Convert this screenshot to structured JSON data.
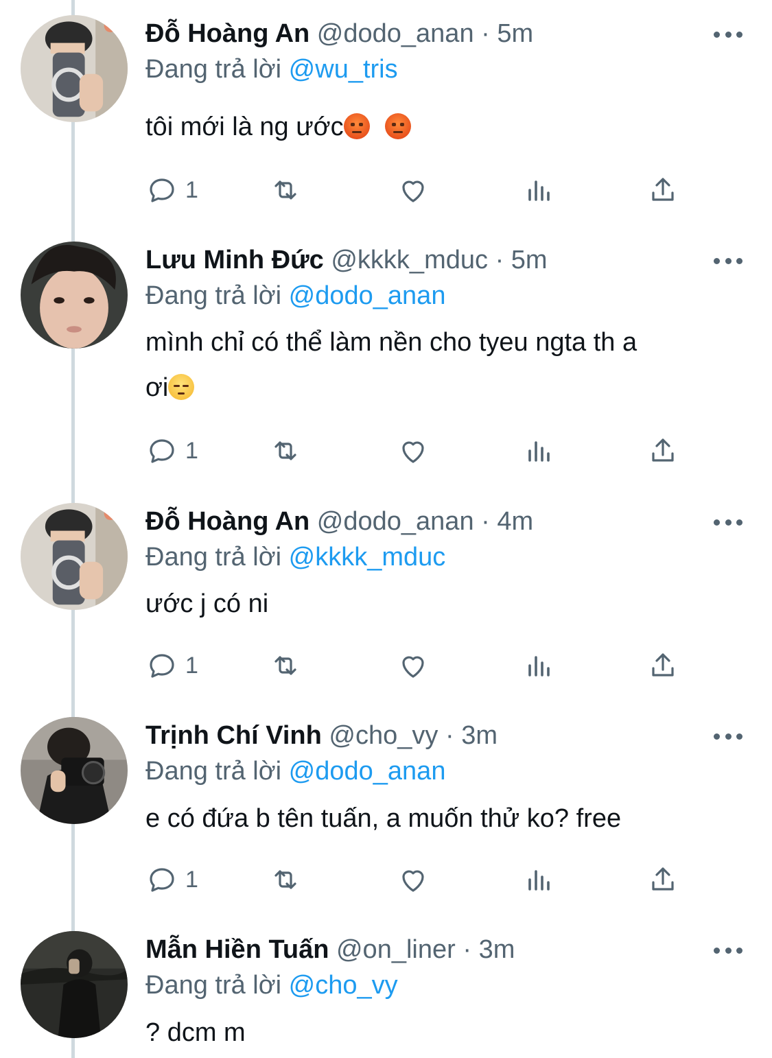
{
  "reply_prefix": "Đang trả lời",
  "tweets": [
    {
      "name": "Đỗ Hoàng An",
      "handle": "@dodo_anan",
      "separator": "·",
      "time": "5m",
      "reply_to": "@wu_tris",
      "text": "tôi mới là ng ước",
      "emojis": [
        "angry-face",
        "angry-face"
      ],
      "reply_count": "1",
      "avatar": "avatar-mirror-selfie"
    },
    {
      "name": "Lưu Minh Đức",
      "handle": "@kkkk_mduc",
      "separator": "·",
      "time": "5m",
      "reply_to": "@dodo_anan",
      "text_line1": "mình chỉ có thể làm nền cho tyeu ngta th a",
      "text_line2": "ơi",
      "emojis": [
        "pensive-face"
      ],
      "reply_count": "1",
      "avatar": "avatar-face-selfie"
    },
    {
      "name": "Đỗ Hoàng An",
      "handle": "@dodo_anan",
      "separator": "·",
      "time": "4m",
      "reply_to": "@kkkk_mduc",
      "text": "ước j có ni",
      "reply_count": "1",
      "avatar": "avatar-mirror-selfie"
    },
    {
      "name": "Trịnh Chí Vinh",
      "handle": "@cho_vy",
      "separator": "·",
      "time": "3m",
      "reply_to": "@dodo_anan",
      "text": "e có đứa b tên tuấn, a muốn thử ko? free",
      "reply_count": "1",
      "avatar": "avatar-camera"
    },
    {
      "name": "Mẫn Hiền Tuấn",
      "handle": "@on_liner",
      "separator": "·",
      "time": "3m",
      "reply_to": "@cho_vy",
      "text": "? dcm m",
      "avatar": "avatar-dark-night"
    }
  ],
  "colors": {
    "text": "#0f1419",
    "muted": "#536471",
    "link": "#1d9bf0",
    "thread_line": "#cfd9de"
  },
  "icons": [
    "reply-icon",
    "retweet-icon",
    "like-icon",
    "views-icon",
    "share-icon",
    "more-icon"
  ]
}
